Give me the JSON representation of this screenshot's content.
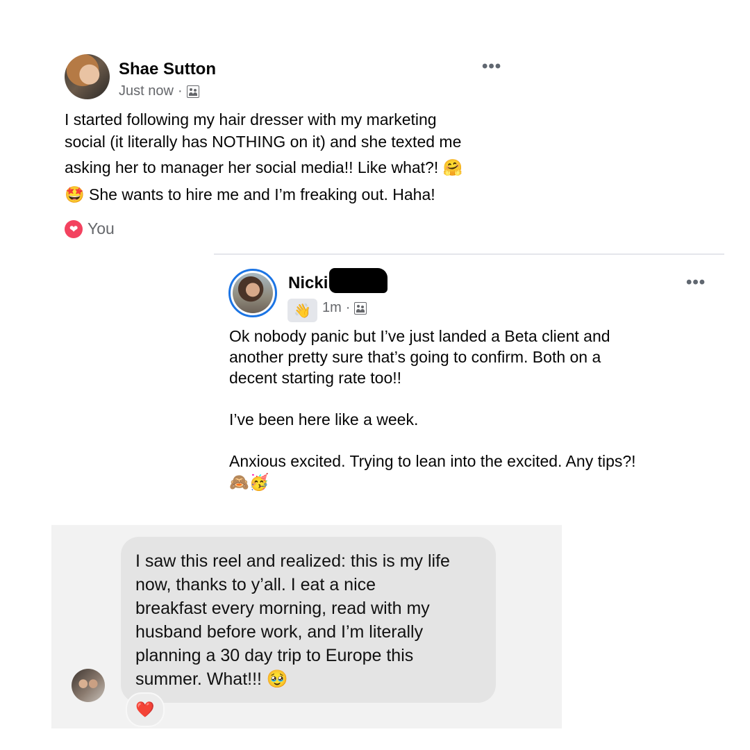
{
  "post1": {
    "author": "Shae Sutton",
    "time": "Just now",
    "separator": "·",
    "audience_icon": "friends-icon",
    "more": "•••",
    "lines": [
      "I started following my hair dresser with my marketing",
      "social (it literally has NOTHING on it) and she texted me",
      "asking her to manager her social media!! Like what?! 🤗",
      "🤩 She wants to hire me and I’m freaking out. Haha!"
    ],
    "reaction": {
      "icon": "heart-icon",
      "label": "You"
    }
  },
  "post2": {
    "author": "Nicki",
    "badge_icon": "waving-hand-icon",
    "badge": "👋",
    "time": "1m",
    "separator": "·",
    "audience_icon": "friends-icon",
    "more": "•••",
    "paragraphs": [
      [
        "Ok nobody panic but I’ve just landed a Beta client and",
        "another pretty sure that’s going to confirm. Both on a",
        "decent starting rate too!!"
      ],
      [
        "I’ve been here like a week."
      ],
      [
        "Anxious excited. Trying to lean into the excited. Any tips?!",
        "🙈🥳"
      ]
    ]
  },
  "message": {
    "lines": [
      "I saw this reel and realized: this is my life",
      "now, thanks to y’all. I eat a nice",
      "breakfast every morning, read with my",
      "husband before work, and I’m literally",
      "planning a 30 day trip to Europe this",
      "summer. What!!! 🥹"
    ],
    "reaction": "❤️"
  }
}
